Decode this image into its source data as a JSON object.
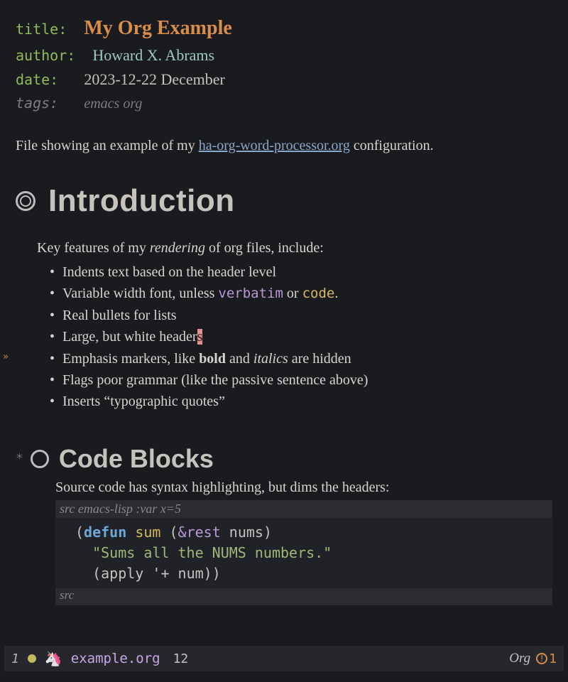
{
  "meta": {
    "title_key": "title",
    "title_val": "My Org Example",
    "author_key": "author",
    "author_val": "Howard X. Abrams",
    "date_key": "date",
    "date_val": "2023-12-22 December",
    "tags_key": "tags",
    "tags_val": "emacs org"
  },
  "intro": {
    "before_link": "File showing an example of my ",
    "link_text": "ha-org-word-processor.org",
    "after_link": " configuration."
  },
  "h1": "Introduction",
  "features_intro": {
    "pre": "Key features of my ",
    "ital": "rendering",
    "post": " of org files, include:"
  },
  "features": {
    "b0": "Indents text based on the header level",
    "b1_pre": "Variable width font, unless ",
    "b1_verb": "verbatim",
    "b1_mid": " or ",
    "b1_code": "code",
    "b1_post": ".",
    "b2": "Real bullets for lists",
    "b3_pre": "Large, but white header",
    "b3_cursor": "s",
    "b4_pre": "Emphasis markers, like ",
    "b4_bold": "bold",
    "b4_mid": " and ",
    "b4_ital": "italics",
    "b4_post": " are hidden",
    "b5": "Flags poor grammar (like the passive sentence above)",
    "b6": "Inserts “typographic quotes”"
  },
  "fringe_arrow": "»",
  "h2_star": "*",
  "h2": "Code Blocks",
  "src": {
    "note": "Source code has syntax highlighting, but dims the headers:",
    "header_src": "src",
    "header_lang": " emacs-lisp :var x=5",
    "footer": "src",
    "line1_open": "(",
    "line1_defun": "defun",
    "line1_sp1": " ",
    "line1_fn": "sum",
    "line1_sp2": " (",
    "line1_amp": "&rest",
    "line1_sp3": " ",
    "line1_arg": "nums",
    "line1_close": ")",
    "line2_indent": "  ",
    "line2_str": "\"Sums all the NUMS numbers.\"",
    "line3_indent": "  ",
    "line3_open": "(",
    "line3_apply": "apply",
    "line3_sp": " ",
    "line3_quote": "'+",
    "line3_sp2": " ",
    "line3_num": "num",
    "line3_close": "))"
  },
  "modeline": {
    "window": "1",
    "filename": "example.org",
    "line": "12",
    "mode": "Org",
    "err_count": "1",
    "unicorn": "🦄"
  }
}
